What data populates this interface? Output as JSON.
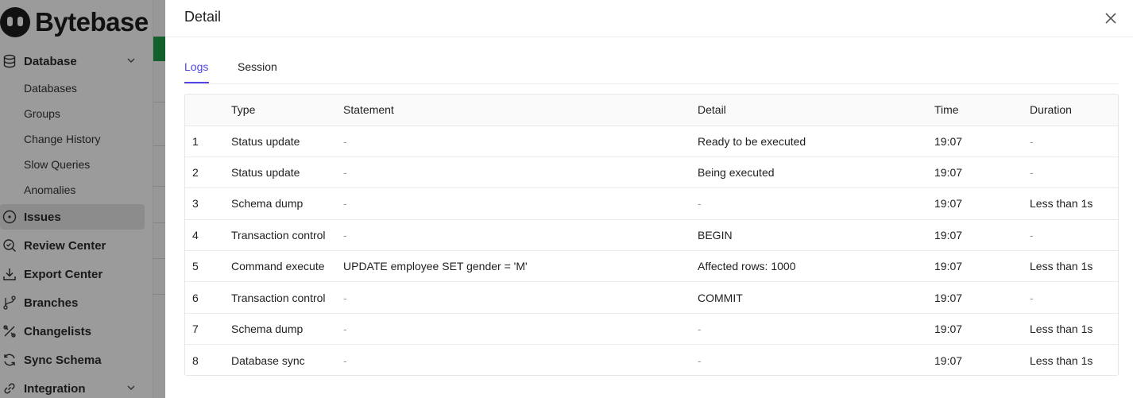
{
  "sidebar": {
    "logo_text": "Bytebase",
    "database": {
      "label": "Database",
      "icon": "database-icon"
    },
    "database_sub": [
      "Databases",
      "Groups",
      "Change History",
      "Slow Queries",
      "Anomalies"
    ],
    "items": [
      {
        "key": "issues",
        "label": "Issues",
        "icon": "issues-icon"
      },
      {
        "key": "review-center",
        "label": "Review Center",
        "icon": "review-icon"
      },
      {
        "key": "export-center",
        "label": "Export Center",
        "icon": "download-icon"
      },
      {
        "key": "branches",
        "label": "Branches",
        "icon": "branch-icon"
      },
      {
        "key": "changelists",
        "label": "Changelists",
        "icon": "changelist-icon"
      },
      {
        "key": "sync-schema",
        "label": "Sync Schema",
        "icon": "sync-icon"
      },
      {
        "key": "integration",
        "label": "Integration",
        "icon": "link-icon"
      }
    ]
  },
  "drawer": {
    "title": "Detail",
    "tabs": [
      {
        "label": "Logs",
        "active": true
      },
      {
        "label": "Session",
        "active": false
      }
    ],
    "table": {
      "columns": [
        "",
        "Type",
        "Statement",
        "Detail",
        "Time",
        "Duration"
      ],
      "rows": [
        [
          "1",
          "Status update",
          "-",
          "Ready to be executed",
          "19:07",
          "-"
        ],
        [
          "2",
          "Status update",
          "-",
          "Being executed",
          "19:07",
          "-"
        ],
        [
          "3",
          "Schema dump",
          "-",
          "-",
          "19:07",
          "Less than 1s"
        ],
        [
          "4",
          "Transaction control",
          "-",
          "BEGIN",
          "19:07",
          "-"
        ],
        [
          "5",
          "Command execute",
          "UPDATE employee SET gender = 'M'",
          "Affected rows: 1000",
          "19:07",
          "Less than 1s"
        ],
        [
          "6",
          "Transaction control",
          "-",
          "COMMIT",
          "19:07",
          "-"
        ],
        [
          "7",
          "Schema dump",
          "-",
          "-",
          "19:07",
          "Less than 1s"
        ],
        [
          "8",
          "Database sync",
          "-",
          "-",
          "19:07",
          "Less than 1s"
        ]
      ]
    }
  },
  "colors": {
    "accent": "#4f46e5",
    "brand_green": "#1f9c4a",
    "overlay": "rgba(0,0,0,0.38)"
  }
}
